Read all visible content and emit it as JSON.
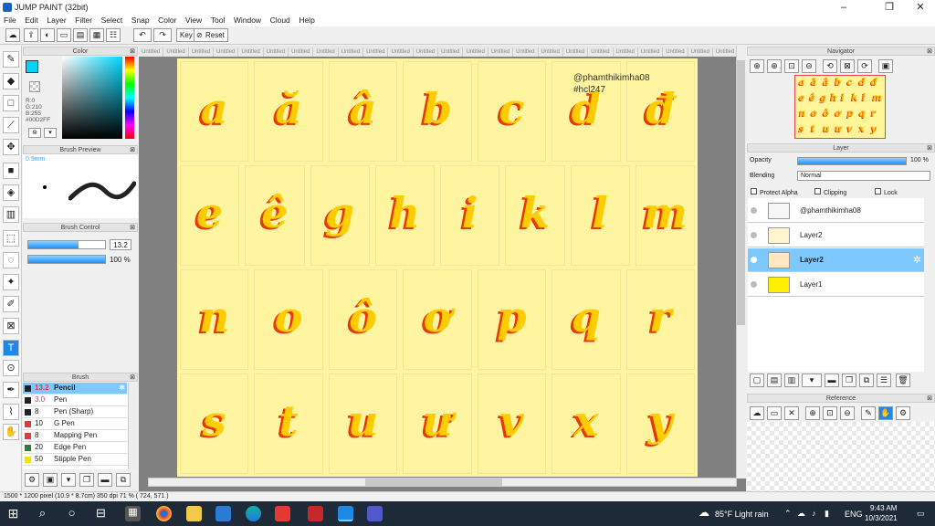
{
  "window": {
    "title": "JUMP PAINT (32bit)"
  },
  "menu": [
    "File",
    "Edit",
    "Layer",
    "Filter",
    "Select",
    "Snap",
    "Color",
    "View",
    "Tool",
    "Window",
    "Cloud",
    "Help"
  ],
  "toolbar": {
    "key_label": "Key",
    "reset_label": "Reset"
  },
  "color_panel": {
    "title": "Color",
    "r": "R:0",
    "g": "G:210",
    "b": "B:255",
    "hex": "#00D2FF"
  },
  "brush_preview": {
    "title": "Brush Preview",
    "size": "0.9mm"
  },
  "brush_control": {
    "title": "Brush Control",
    "size_value": "13.2",
    "opacity_value": "100 %",
    "size_fraction": 0.66,
    "opacity_fraction": 1.0
  },
  "brush": {
    "title": "Brush",
    "items": [
      {
        "size": "13.2",
        "name": "Pencil",
        "color": "#222222"
      },
      {
        "size": "3.0",
        "name": "Pen",
        "color": "#222222"
      },
      {
        "size": "8",
        "name": "Pen (Sharp)",
        "color": "#222222"
      },
      {
        "size": "10",
        "name": "G Pen",
        "color": "#e53935"
      },
      {
        "size": "8",
        "name": "Mapping Pen",
        "color": "#e53935"
      },
      {
        "size": "20",
        "name": "Edge Pen",
        "color": "#2e7d32"
      },
      {
        "size": "50",
        "name": "Stipple Pen",
        "color": "#f9e000"
      }
    ]
  },
  "tabs": [
    "Untitled",
    "Untitled",
    "Untitled",
    "Untitled",
    "Untitled",
    "Untitled",
    "Untitled",
    "Untitled",
    "Untitled",
    "Untitled",
    "Untitled",
    "Untitled",
    "Untitled",
    "Untitled",
    "Untitled",
    "Untitled",
    "Untitled",
    "Untitled",
    "Untitled",
    "Untitled",
    "Untitled",
    "Untitled",
    "Untitled",
    "Untitled",
    "Untitled"
  ],
  "canvas": {
    "watermark_line1": "@phamthikimha08",
    "watermark_line2": "#hcl247",
    "rows": [
      [
        "a",
        "ă",
        "â",
        "b",
        "c",
        "d",
        "đ"
      ],
      [
        "e",
        "ê",
        "g",
        "h",
        "i",
        "k",
        "l",
        "m"
      ],
      [
        "n",
        "o",
        "ô",
        "ơ",
        "p",
        "q",
        "r"
      ],
      [
        "s",
        "t",
        "u",
        "ư",
        "v",
        "x",
        "y"
      ]
    ]
  },
  "navigator": {
    "title": "Navigator"
  },
  "layer_panel": {
    "title": "Layer",
    "opacity_label": "Opacity",
    "opacity_value": "100 %",
    "blending_label": "Blending",
    "blending_value": "Normal",
    "protect_alpha": "Protect Alpha",
    "clipping": "Clipping",
    "lock": "Lock",
    "layers": [
      {
        "name": "@phamthikimha08",
        "selected": false
      },
      {
        "name": "Layer2",
        "selected": false
      },
      {
        "name": "Layer2",
        "selected": true
      },
      {
        "name": "Layer1",
        "selected": false
      }
    ]
  },
  "reference": {
    "title": "Reference"
  },
  "status": {
    "text": "1500 * 1200 pixel  (10.9 * 8.7cm)  350 dpi  71 %  ( 724, 571 )"
  },
  "taskbar": {
    "weather": "85°F  Light rain",
    "lang": "ENG",
    "time": "9:43 AM",
    "date": "10/3/2021"
  }
}
